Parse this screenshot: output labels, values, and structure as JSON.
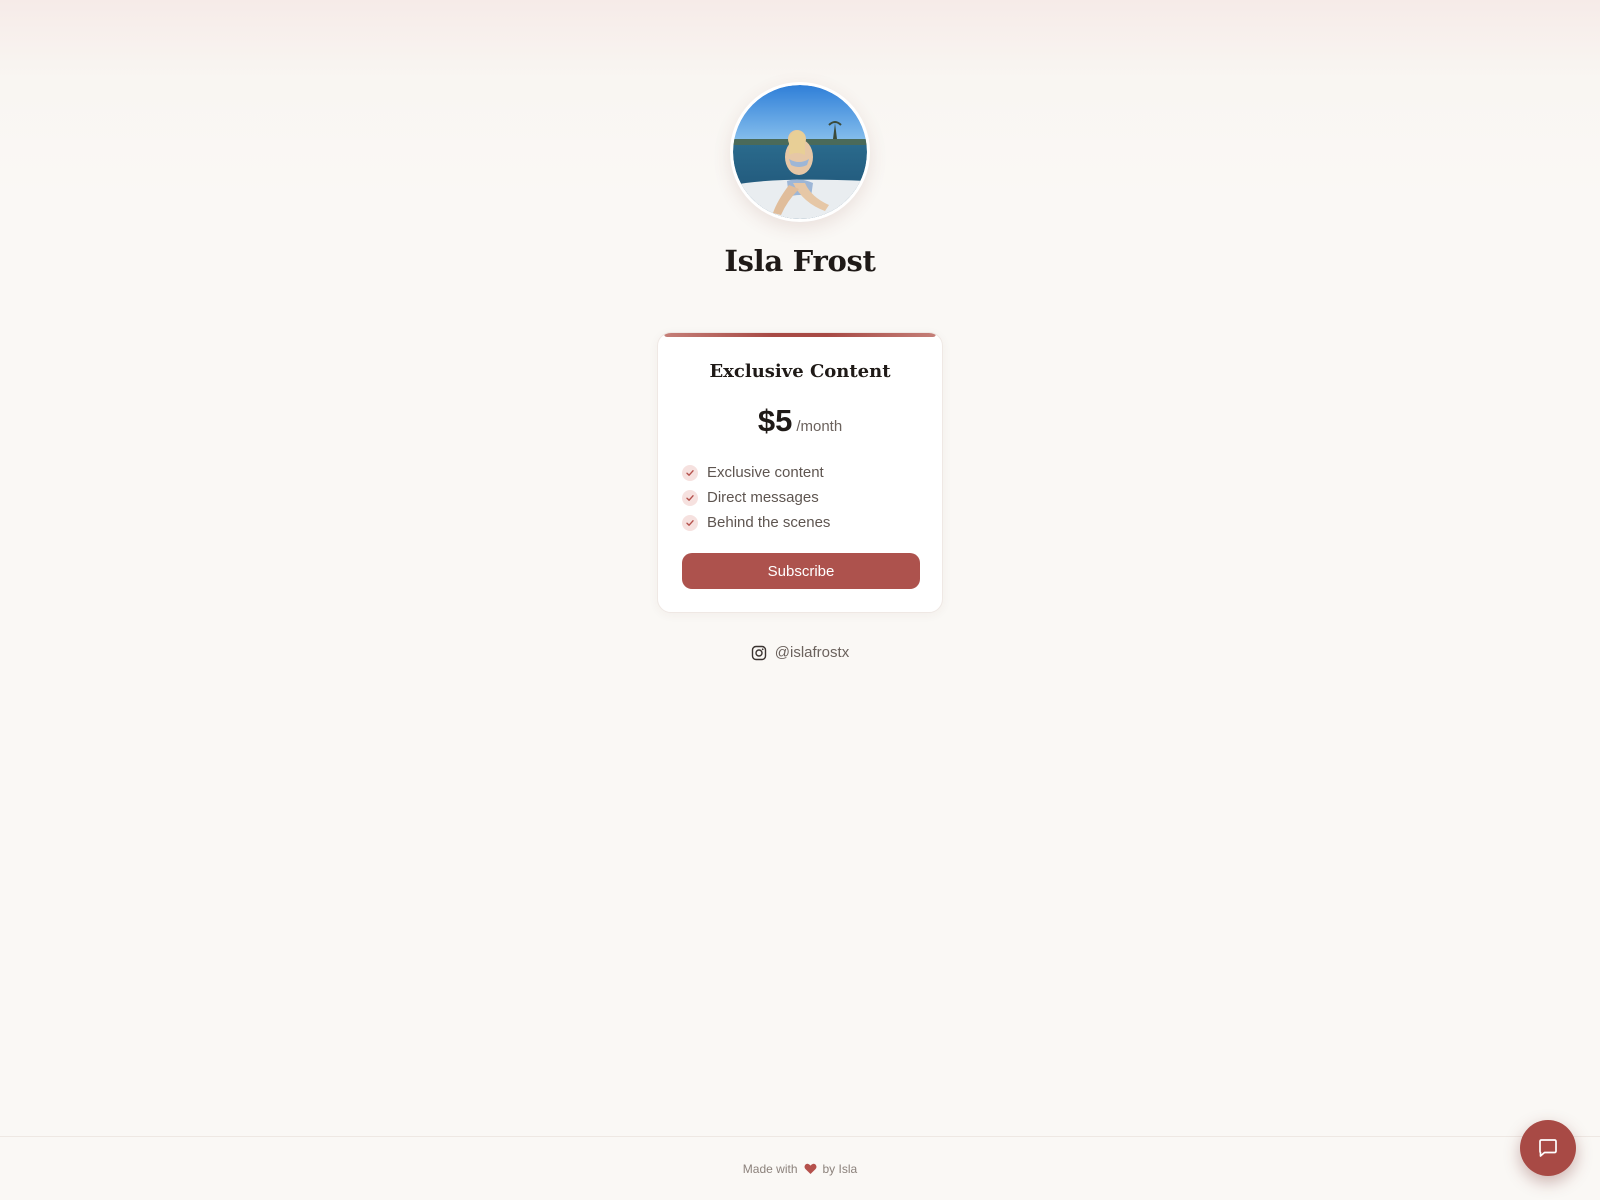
{
  "profile": {
    "name": "Isla Frost",
    "avatar_icon": "profile-photo"
  },
  "tier": {
    "title": "Exclusive Content",
    "price": "$5",
    "period": "/month",
    "features": [
      "Exclusive content",
      "Direct messages",
      "Behind the scenes"
    ],
    "button_label": "Subscribe"
  },
  "social": {
    "icon": "instagram-icon",
    "handle": "@islafrostx"
  },
  "footer": {
    "made_with": "Made with",
    "by": "by Isla"
  },
  "colors": {
    "accent": "#ad524d",
    "background": "#faf8f5"
  },
  "chat": {
    "icon": "chat-bubble-icon"
  }
}
